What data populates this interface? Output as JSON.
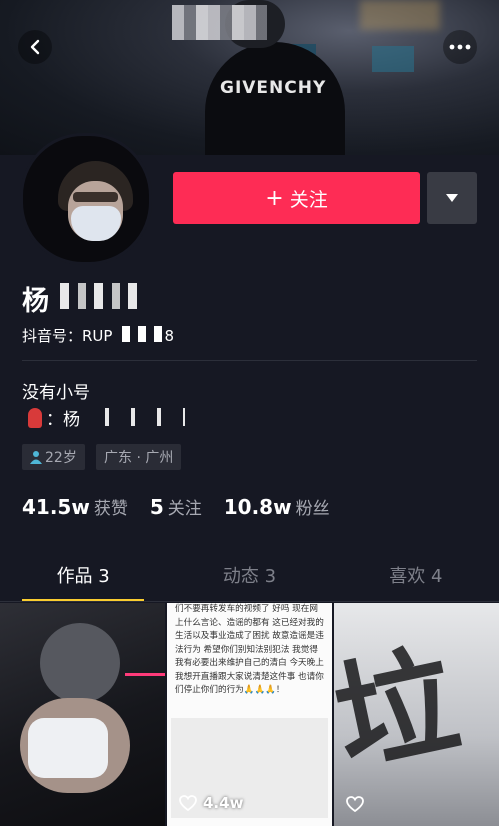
{
  "profile": {
    "name": "杨",
    "douyin_id": "抖音号：RUP",
    "douyin_id_suffix": "8",
    "follow_label": "关注",
    "bio_line1": "没有小号",
    "bio_line2_prefix": "：杨",
    "age_tag": "22岁",
    "location_tag": "广东 · 广州"
  },
  "stats": [
    {
      "num": "41.5w",
      "label": "获赞"
    },
    {
      "num": "5",
      "label": "关注"
    },
    {
      "num": "10.8w",
      "label": "粉丝"
    }
  ],
  "tabs": [
    {
      "label": "作品 3",
      "active": true
    },
    {
      "label": "动态 3",
      "active": false
    },
    {
      "label": "喜欢 4",
      "active": false
    }
  ],
  "cover": {
    "brand_text": "GIVENCHY"
  },
  "videos": [
    {
      "likes": ""
    },
    {
      "likes": "4.4w",
      "caption": "们不要再转发车的视频了 好吗 现在网上什么言论、造谣的都有 这已经对我的生活以及事业造成了困扰 故意造谣是违法行为 希望你们别知法别犯法 我觉得我有必要出来维护自己的清白 今天晚上我想开直播跟大家说清楚这件事 也请你们停止你们的行为🙏🙏🙏！"
    },
    {
      "likes": "",
      "graffiti": "垃"
    }
  ],
  "colors": {
    "background": "#161823",
    "follow_button": "#fe2c55",
    "tab_indicator": "#facd30",
    "secondary_text": "#a7a9b2"
  }
}
